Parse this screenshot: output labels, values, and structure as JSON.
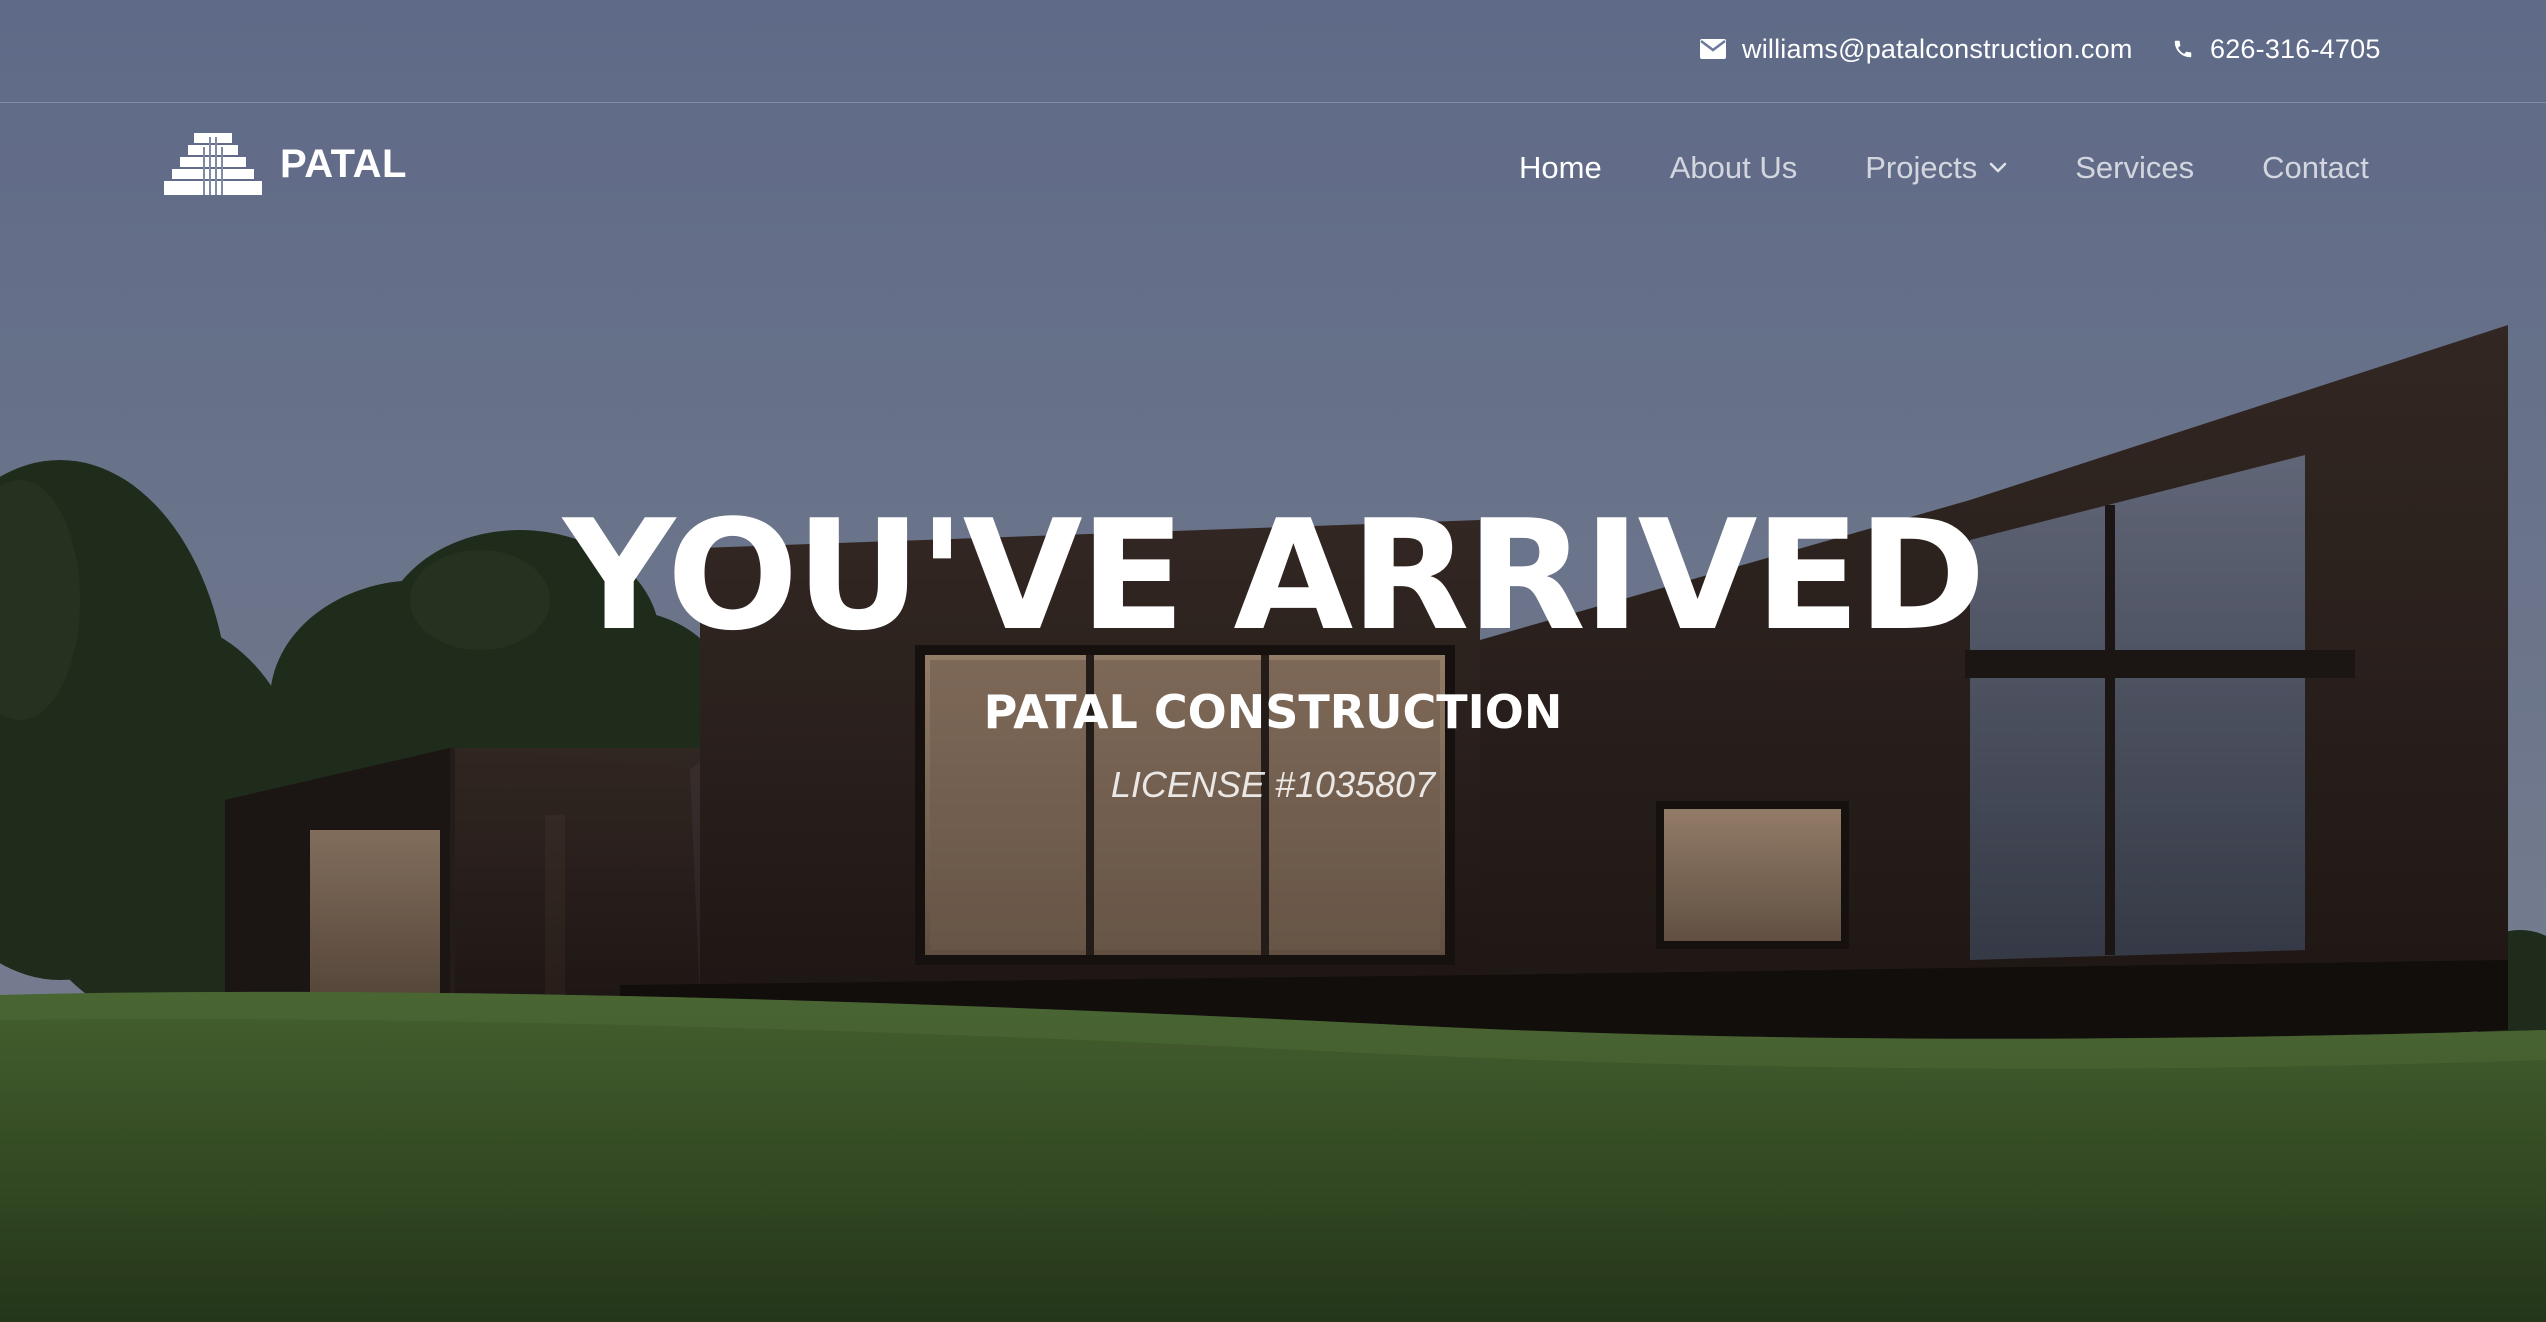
{
  "topbar": {
    "email": "williams@patalconstruction.com",
    "phone": "626-316-4705",
    "email_icon": "envelope-icon",
    "phone_icon": "phone-icon"
  },
  "header": {
    "logo_text": "PATAL",
    "logo_icon": "pyramid-logo-icon"
  },
  "nav": {
    "items": [
      {
        "label": "Home",
        "active": true
      },
      {
        "label": "About Us"
      },
      {
        "label": "Projects",
        "has_dropdown": true
      },
      {
        "label": "Services"
      },
      {
        "label": "Contact"
      }
    ]
  },
  "hero": {
    "title": "YOU'VE ARRIVED",
    "subtitle": "PATAL CONSTRUCTION",
    "license": "LICENSE #1035807"
  },
  "colors": {
    "sky_top": "#6e7b9a",
    "sky_bottom": "#8a93a8",
    "grass": "#3f5a2b",
    "building": "#2b211e",
    "window_glow": "#c9a77a"
  }
}
